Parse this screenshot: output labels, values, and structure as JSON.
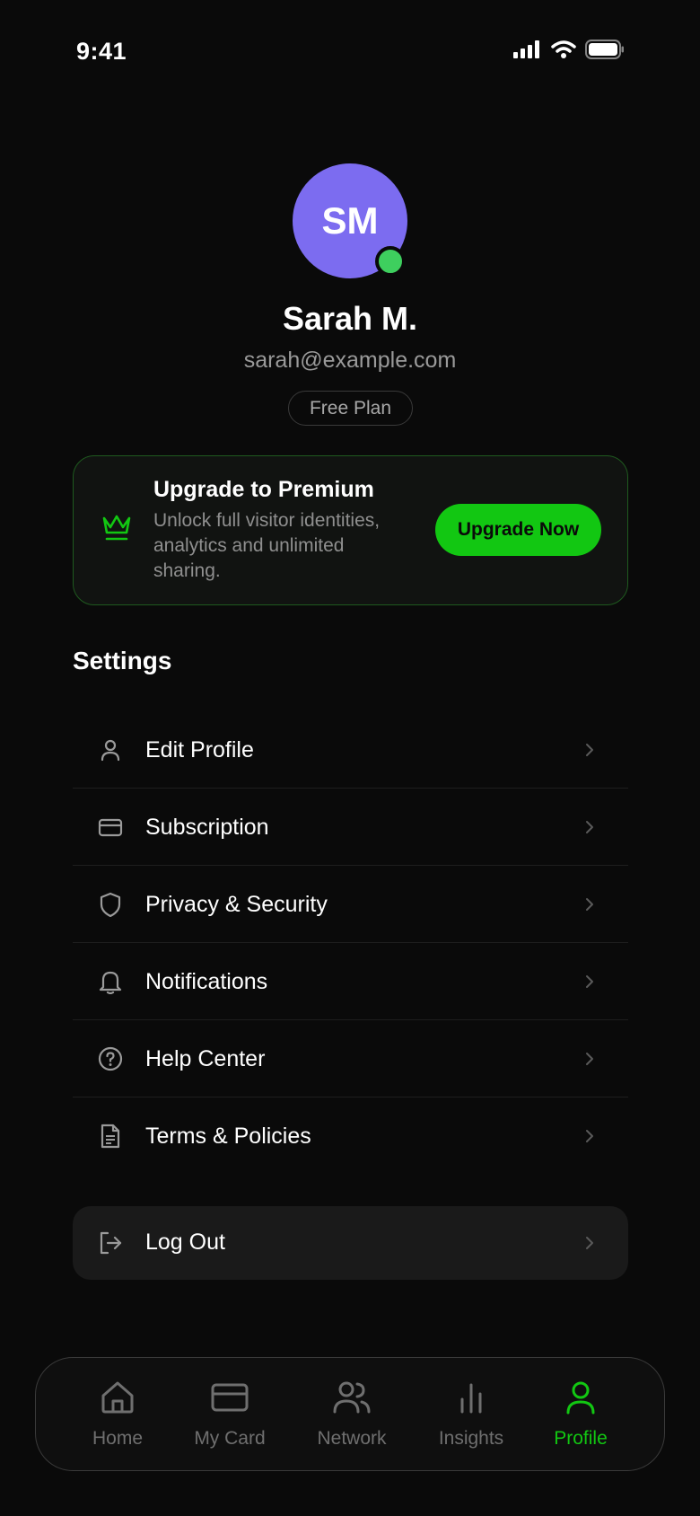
{
  "status": {
    "time": "9:41"
  },
  "profile": {
    "initials": "SM",
    "name": "Sarah M.",
    "email": "sarah@example.com",
    "plan": "Free Plan"
  },
  "premium": {
    "title": "Upgrade to Premium",
    "description": "Unlock full visitor identities, analytics and unlimited sharing.",
    "button_label": "Upgrade Now"
  },
  "settings": {
    "heading": "Settings",
    "items": [
      {
        "label": "Edit Profile",
        "icon": "user-icon"
      },
      {
        "label": "Subscription",
        "icon": "credit-card-icon"
      },
      {
        "label": "Privacy & Security",
        "icon": "shield-icon"
      },
      {
        "label": "Notifications",
        "icon": "bell-icon"
      },
      {
        "label": "Help Center",
        "icon": "help-circle-icon"
      },
      {
        "label": "Terms & Policies",
        "icon": "document-icon"
      }
    ],
    "logout_label": "Log Out"
  },
  "tabs": [
    {
      "label": "Home",
      "icon": "home-icon",
      "active": false
    },
    {
      "label": "My Card",
      "icon": "card-icon",
      "active": false
    },
    {
      "label": "Network",
      "icon": "users-icon",
      "active": false
    },
    {
      "label": "Insights",
      "icon": "bar-chart-icon",
      "active": false
    },
    {
      "label": "Profile",
      "icon": "user-icon",
      "active": true
    }
  ],
  "colors": {
    "background": "#0a0a0a",
    "accent": "#12c712",
    "avatar": "#7c6cf0",
    "online": "#3ecf5e"
  }
}
